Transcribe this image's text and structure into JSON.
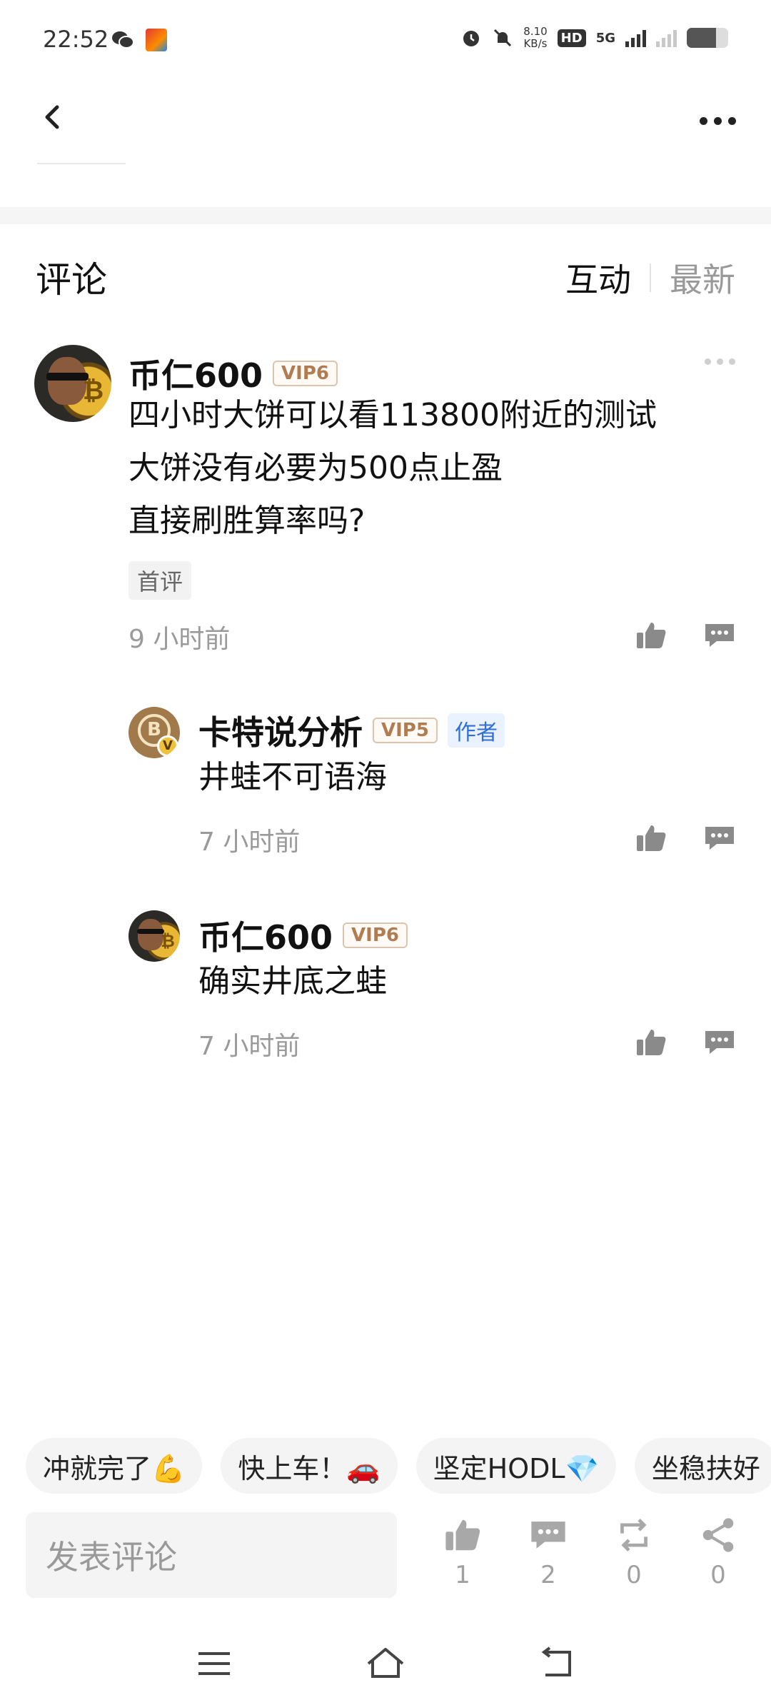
{
  "status_bar": {
    "time": "22:52",
    "net_speed_value": "8.10",
    "net_speed_unit": "KB/s",
    "hd_label": "HD",
    "hd_sub": "1",
    "network": "5G"
  },
  "header": {
    "back_icon": "chevron-left-icon",
    "more_icon": "more-horizontal-icon"
  },
  "comments_section": {
    "title": "评论",
    "sort_tabs": [
      {
        "label": "互动",
        "active": true
      },
      {
        "label": "最新",
        "active": false
      }
    ]
  },
  "comments": [
    {
      "user": "币仁600",
      "vip": "VIP6",
      "lines": [
        "四小时大饼可以看113800附近的测试",
        "大饼没有必要为500点止盈",
        "直接刷胜算率吗?"
      ],
      "tag": "首评",
      "time": "9 小时前",
      "replies": [
        {
          "user": "卡特说分析",
          "vip": "VIP5",
          "author_badge": "作者",
          "text": "井蛙不可语海",
          "time": "7 小时前"
        },
        {
          "user": "币仁600",
          "vip": "VIP6",
          "text": "确实井底之蛙",
          "time": "7 小时前"
        }
      ]
    }
  ],
  "quick_replies": [
    "冲就完了💪",
    "快上车！🚗",
    "坚定HODL💎",
    "坐稳扶好"
  ],
  "bottom_bar": {
    "input_placeholder": "发表评论",
    "like_count": "1",
    "comment_count": "2",
    "repost_count": "0",
    "share_count": "0"
  },
  "colors": {
    "vip_text": "#b07d52",
    "author_badge": "#2f6fd6",
    "muted": "#9a9a9a"
  }
}
